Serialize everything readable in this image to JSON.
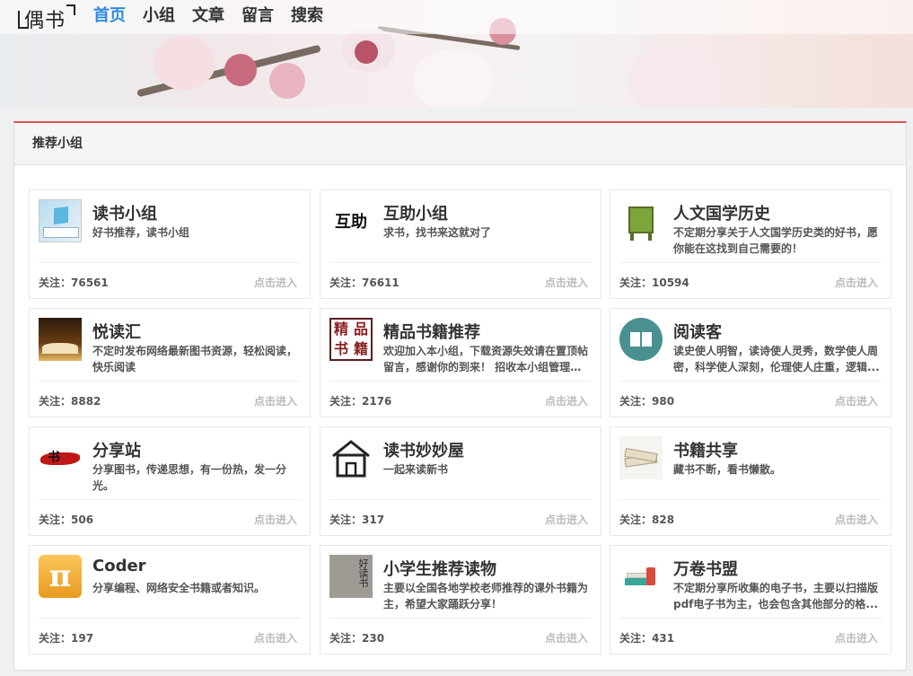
{
  "header": {
    "logo_text": "偶书",
    "nav": [
      {
        "label": "首页",
        "active": true
      },
      {
        "label": "小组",
        "active": false
      },
      {
        "label": "文章",
        "active": false
      },
      {
        "label": "留言",
        "active": false
      },
      {
        "label": "搜索",
        "active": false
      }
    ]
  },
  "panel": {
    "title": "推荐小组"
  },
  "groups": [
    {
      "title": "读书小组",
      "desc": "好书推荐，读书小组",
      "follow": "关注：76561",
      "enter": "点击进入",
      "icon": "book-cube-icon"
    },
    {
      "title": "互助小组",
      "desc": "求书，找书来这就对了",
      "follow": "关注：76611",
      "enter": "点击进入",
      "icon": "huzhu-text-icon",
      "icon_text": "互助"
    },
    {
      "title": "人文国学历史",
      "desc": "不定期分享关于人文国学历史类的好书，愿你能在这找到自己需要的！",
      "follow": "关注：10594",
      "enter": "点击进入",
      "icon": "bronze-vessel-icon"
    },
    {
      "title": "悦读汇",
      "desc": "不定时发布网络最新图书资源，轻松阅读，快乐阅读",
      "follow": "关注：8882",
      "enter": "点击进入",
      "icon": "open-book-icon"
    },
    {
      "title": "精品书籍推荐",
      "desc": "欢迎加入本小组，下载资源失效请在置顶帖留言，感谢你的到来！ 招收本小组管理员...",
      "follow": "关注：2176",
      "enter": "点击进入",
      "icon": "jingpin-stamp-icon",
      "icon_text": [
        "精",
        "品",
        "书",
        "籍"
      ]
    },
    {
      "title": "阅读客",
      "desc": "读史使人明智，读诗使人灵秀，数学使人周密，科学使人深刻，伦理使人庄重，逻辑...",
      "follow": "关注：980",
      "enter": "点击进入",
      "icon": "book-circle-icon"
    },
    {
      "title": "分享站",
      "desc": "分享图书，传递思想，有一份热，发一分光。",
      "follow": "关注：506",
      "enter": "点击进入",
      "icon": "brush-stroke-icon",
      "icon_text": "书"
    },
    {
      "title": "读书妙妙屋",
      "desc": "一起来读新书",
      "follow": "关注：317",
      "enter": "点击进入",
      "icon": "house-icon"
    },
    {
      "title": "书籍共享",
      "desc": "藏书不断，看书懒散。",
      "follow": "关注：828",
      "enter": "点击进入",
      "icon": "books-pile-icon"
    },
    {
      "title": "Coder",
      "desc": "分享编程、网络安全书籍或者知识。",
      "follow": "关注：197",
      "enter": "点击进入",
      "icon": "pi-icon",
      "icon_text": "π"
    },
    {
      "title": "小学生推荐读物",
      "desc": "主要以全国各地学校老师推荐的课外书籍为主，希望大家踊跃分享！",
      "follow": "关注：230",
      "enter": "点击进入",
      "icon": "calligraphy-icon",
      "icon_text": "好读书"
    },
    {
      "title": "万卷书盟",
      "desc": "不定期分享所收集的电子书，主要以扫描版pdf电子书为主，也会包含其他部分的格...",
      "follow": "关注：431",
      "enter": "点击进入",
      "icon": "book-stack-icon"
    }
  ]
}
